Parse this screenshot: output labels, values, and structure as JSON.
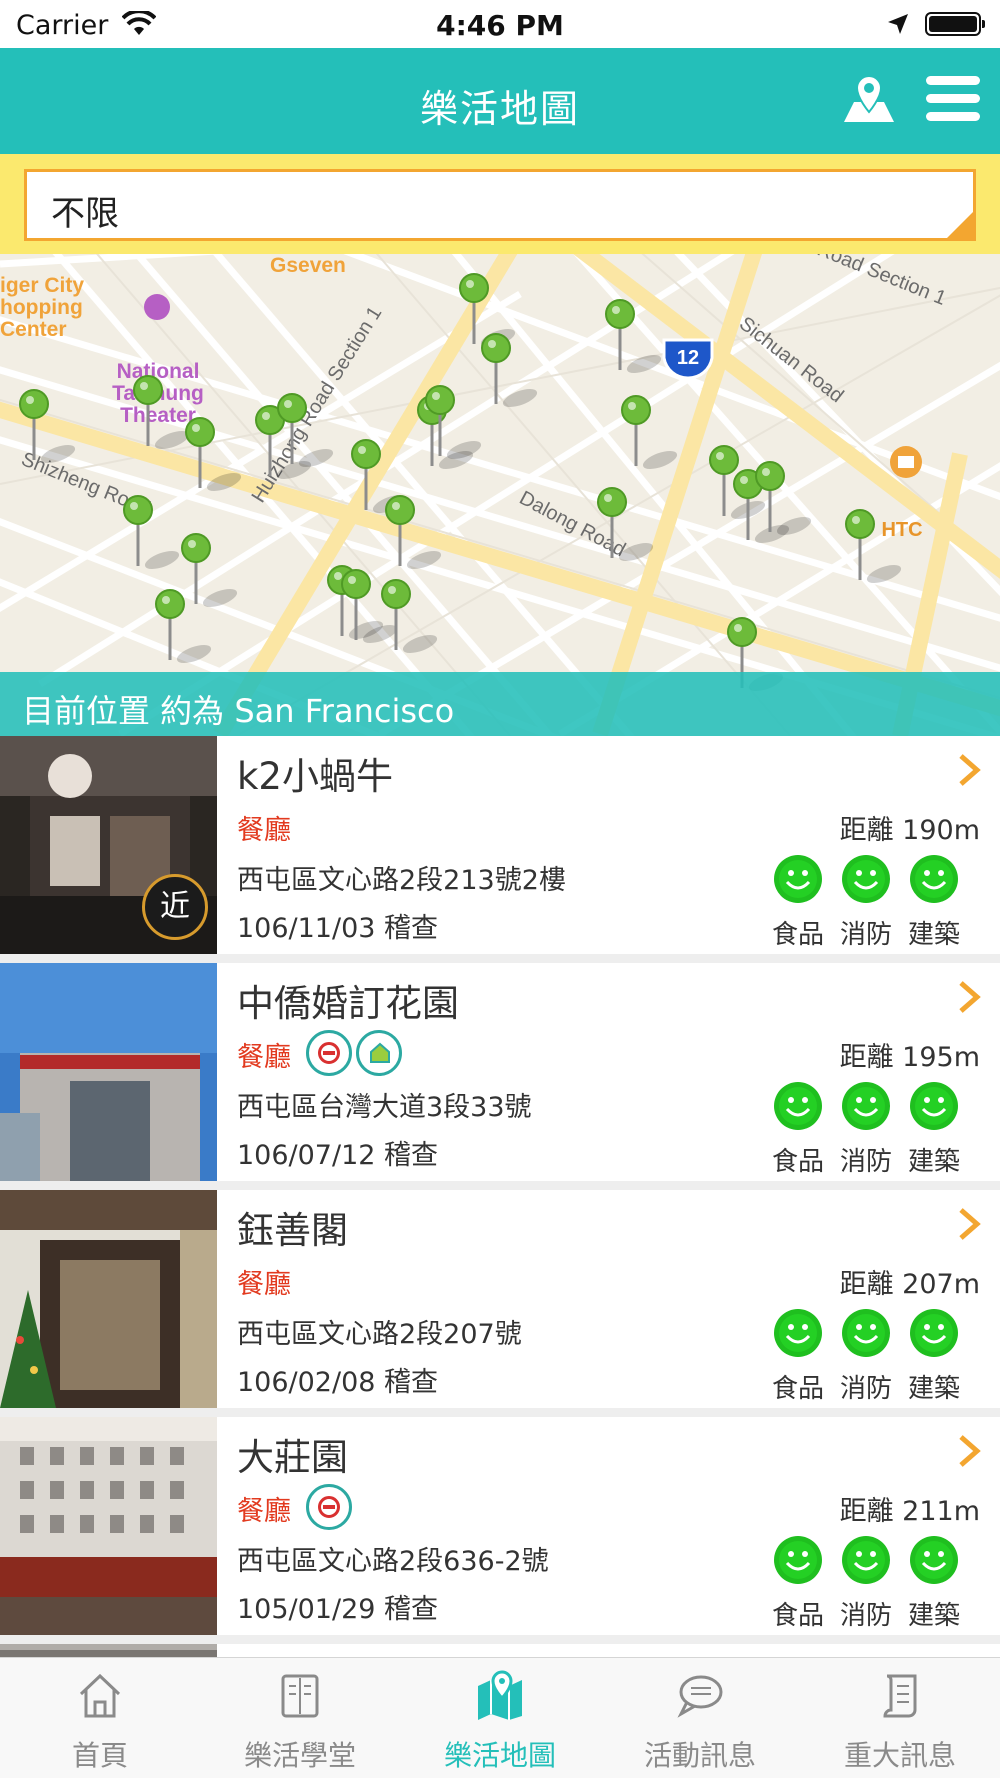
{
  "status_bar": {
    "carrier": "Carrier",
    "time": "4:46 PM"
  },
  "header": {
    "title": "樂活地圖",
    "map_icon": "map-pin-icon",
    "menu_icon": "hamburger-menu-icon"
  },
  "filter": {
    "value": "不限"
  },
  "map": {
    "labels": {
      "poi1": "iger City",
      "poi2": "hopping",
      "poi3": "Center",
      "gseven": "Gseven",
      "theater1": "National",
      "theater2": "Taichung",
      "theater3": "Theater",
      "shizheng": "Shizheng Road",
      "huizhong": "Huizhong Road Section 1",
      "dalong": "Dalong Road",
      "sichuan": "Sichuan Road",
      "road_section": "Road Section 1",
      "htc": "HTC",
      "route": "12"
    },
    "current_location": "目前位置 約為 San Francisco"
  },
  "list": [
    {
      "name": "k2小蝸牛",
      "category": "餐廳",
      "distance": "距離 190m",
      "address": "西屯區文心路2段213號2樓",
      "inspected": "106/11/03 稽查",
      "near_badge": "近",
      "certs": [],
      "ratings": [
        "食品",
        "消防",
        "建築"
      ]
    },
    {
      "name": "中僑婚訂花園",
      "category": "餐廳",
      "distance": "距離 195m",
      "address": "西屯區台灣大道3段33號",
      "inspected": "106/07/12 稽查",
      "certs": [
        "safety-cert-icon",
        "house-cert-icon"
      ],
      "ratings": [
        "食品",
        "消防",
        "建築"
      ]
    },
    {
      "name": "鈺善閣",
      "category": "餐廳",
      "distance": "距離 207m",
      "address": "西屯區文心路2段207號",
      "inspected": "106/02/08 稽查",
      "certs": [],
      "ratings": [
        "食品",
        "消防",
        "建築"
      ]
    },
    {
      "name": "大莊園",
      "category": "餐廳",
      "distance": "距離 211m",
      "address": "西屯區文心路2段636-2號",
      "inspected": "105/01/29 稽查",
      "certs": [
        "safety-cert-icon"
      ],
      "ratings": [
        "食品",
        "消防",
        "建築"
      ]
    }
  ],
  "tabs": [
    {
      "label": "首頁",
      "icon": "home-icon"
    },
    {
      "label": "樂活學堂",
      "icon": "book-icon"
    },
    {
      "label": "樂活地圖",
      "icon": "map-icon"
    },
    {
      "label": "活動訊息",
      "icon": "chat-bubble-icon"
    },
    {
      "label": "重大訊息",
      "icon": "scroll-icon"
    }
  ],
  "colors": {
    "accent": "#24bfb9",
    "filter_bg": "#fbe96e",
    "category": "#e23a1f",
    "smiley": "#1fbf1f",
    "chevron": "#f3a630"
  }
}
